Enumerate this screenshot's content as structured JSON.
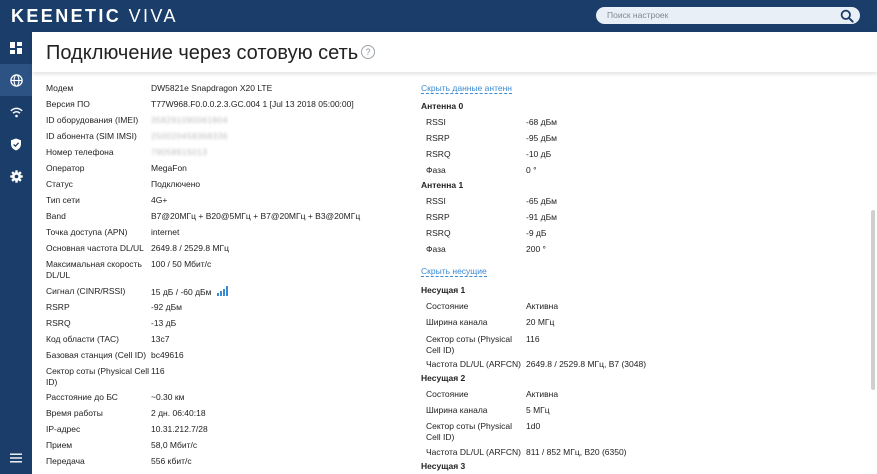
{
  "brand": {
    "part1": "KEENETIC",
    "part2": "VIVA"
  },
  "search": {
    "placeholder": "Поиск настроек"
  },
  "page": {
    "title": "Подключение через сотовую сеть",
    "help": "?"
  },
  "left_rows": [
    {
      "label": "Модем",
      "value": "DW5821e Snapdragon X20 LTE"
    },
    {
      "label": "Версия ПО",
      "value": "T77W968.F0.0.0.2.3.GC.004 1 [Jul 13 2018 05:00:00]"
    },
    {
      "label": "ID оборудования (IMEI)",
      "value": "358291090061804"
    },
    {
      "label": "ID абонента (SIM IMSI)",
      "value": "250020458368336"
    },
    {
      "label": "Номер телефона",
      "value": "79058915013"
    },
    {
      "label": "Оператор",
      "value": "MegaFon"
    },
    {
      "label": "Статус",
      "value": "Подключено"
    },
    {
      "label": "Тип сети",
      "value": "4G+"
    },
    {
      "label": "Band",
      "value": "B7@20МГц + B20@5МГц + B7@20МГц + B3@20МГц"
    },
    {
      "label": "Точка доступа (APN)",
      "value": "internet"
    },
    {
      "label": "Основная частота DL/UL",
      "value": "2649.8 / 2529.8 МГц"
    },
    {
      "label": "Максимальная скорость",
      "label2": "DL/UL",
      "value": "100 / 50 Мбит/с"
    },
    {
      "label": "Сигнал (CINR/RSSI)",
      "value": "15 дБ / -60 дБм"
    },
    {
      "label": "RSRP",
      "value": "-92 дБм"
    },
    {
      "label": "RSRQ",
      "value": "-13 дБ"
    },
    {
      "label": "Код области (TAC)",
      "value": "13c7"
    },
    {
      "label": "Базовая станция (Cell ID)",
      "value": "bc49616"
    },
    {
      "label": "Сектор соты (Physical Cell",
      "label2": "ID)",
      "value": "116"
    },
    {
      "label": "Расстояние до БС",
      "value": "~0.30 км"
    },
    {
      "label": "Время работы",
      "value": "2 дн. 06:40:18"
    },
    {
      "label": "IP-адрес",
      "value": "10.31.212.7/28"
    },
    {
      "label": "Прием",
      "value": "58,0 Мбит/с"
    },
    {
      "label": "Передача",
      "value": "556 кбит/с"
    }
  ],
  "antennas": {
    "toggle": "Скрыть данные антенн",
    "list": [
      {
        "name": "Антенна 0",
        "rows": [
          {
            "label": "RSSI",
            "value": "-68 дБм"
          },
          {
            "label": "RSRP",
            "value": "-95 дБм"
          },
          {
            "label": "RSRQ",
            "value": "-10 дБ"
          },
          {
            "label": "Фаза",
            "value": "0 °"
          }
        ]
      },
      {
        "name": "Антенна 1",
        "rows": [
          {
            "label": "RSSI",
            "value": "-65 дБм"
          },
          {
            "label": "RSRP",
            "value": "-91 дБм"
          },
          {
            "label": "RSRQ",
            "value": "-9 дБ"
          },
          {
            "label": "Фаза",
            "value": "200 °"
          }
        ]
      }
    ]
  },
  "carriers": {
    "toggle": "Скрыть несущие",
    "list": [
      {
        "name": "Несущая 1",
        "rows": [
          {
            "label": "Состояние",
            "value": "Активна"
          },
          {
            "label": "Ширина канала",
            "value": "20 МГц"
          },
          {
            "label": "Сектор соты (Physical",
            "label2": "Cell ID)",
            "value": "116"
          },
          {
            "label": "Частота DL/UL (ARFCN)",
            "value": "2649.8 / 2529.8 МГц, B7 (3048)"
          }
        ]
      },
      {
        "name": "Несущая 2",
        "rows": [
          {
            "label": "Состояние",
            "value": "Активна"
          },
          {
            "label": "Ширина канала",
            "value": "5 МГц"
          },
          {
            "label": "Сектор соты (Physical",
            "label2": "Cell ID)",
            "value": "1d0"
          },
          {
            "label": "Частота DL/UL (ARFCN)",
            "value": "811 / 852 МГц, B20 (6350)"
          }
        ]
      },
      {
        "name": "Несущая 3",
        "rows": []
      }
    ]
  },
  "colors": {
    "brand": "#1a3d6a",
    "active": "#2c5384",
    "link": "#3b8ad4"
  },
  "icons": {
    "signal_bars": "signal-bars-icon"
  }
}
